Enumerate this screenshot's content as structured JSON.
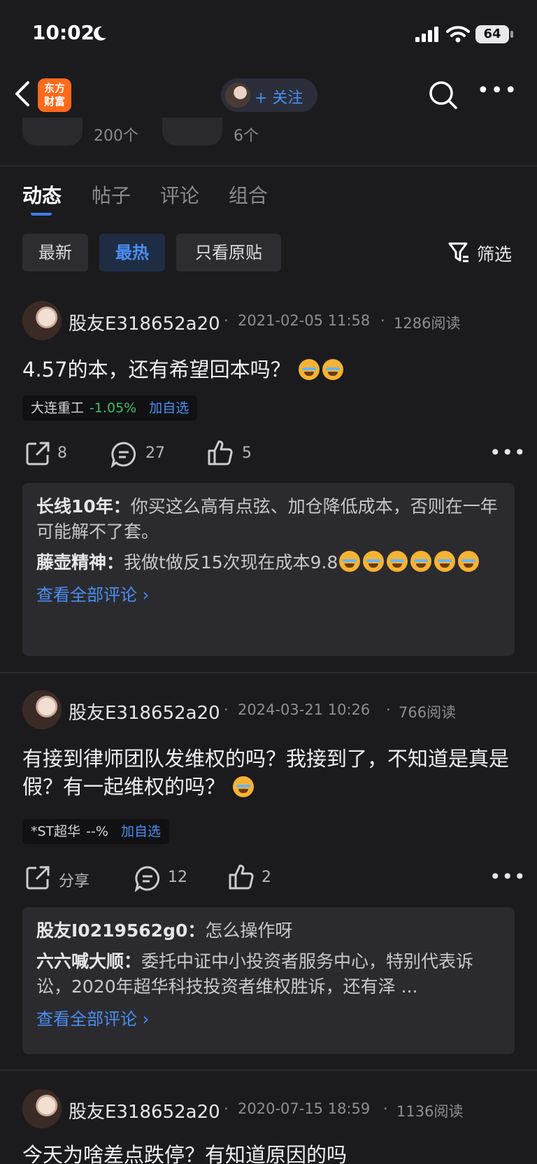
{
  "status_bar": {
    "time": "10:02",
    "battery": "64"
  },
  "nav": {
    "logo_line1": "东方",
    "logo_line2": "财富",
    "follow_label": "+ 关注"
  },
  "stats": [
    {
      "count": "200个"
    },
    {
      "count": "6个"
    }
  ],
  "tabs": [
    {
      "label": "动态"
    },
    {
      "label": "帖子"
    },
    {
      "label": "评论"
    },
    {
      "label": "组合"
    }
  ],
  "filters": {
    "chips": [
      {
        "label": "最新"
      },
      {
        "label": "最热"
      },
      {
        "label": "只看原贴"
      }
    ],
    "filter_label": "筛选"
  },
  "colors": {
    "accent": "#4a8ef2",
    "down": "#3fbf6a",
    "background": "#1b1b1d"
  },
  "posts": [
    {
      "username": "股友E318652a20",
      "date": "2021-02-05 11:58",
      "reads": "1286阅读",
      "text": "4.57的本，还有希望回本吗？",
      "stock": {
        "name": "大连重工",
        "change": "-1.05%",
        "add": "加自选"
      },
      "share": "8",
      "comments": "27",
      "likes": "5",
      "replies": [
        {
          "user": "长线10年：",
          "text": "你买这么高有点弦、加仓降低成本，否则在一年可能解不了套。"
        },
        {
          "user": "藤壶精神：",
          "text": "我做t做反15次现在成本9.8"
        }
      ],
      "view_all": "查看全部评论 ›"
    },
    {
      "username": "股友E318652a20",
      "date": "2024-03-21 10:26",
      "reads": "766阅读",
      "text": "有接到律师团队发维权的吗？我接到了，不知道是真是假？有一起维权的吗？",
      "stock": {
        "name": "*ST超华",
        "change": "--%",
        "add": "加自选"
      },
      "share": "分享",
      "comments": "12",
      "likes": "2",
      "replies": [
        {
          "user": "股友I0219562g0：",
          "text": "怎么操作呀"
        },
        {
          "user": "六六喊大顺：",
          "text": "委托中证中小投资者服务中心，特别代表诉讼，2020年超华科技投资者维权胜诉，还有泽 ..."
        }
      ],
      "view_all": "查看全部评论 ›"
    },
    {
      "username": "股友E318652a20",
      "date": "2020-07-15 18:59",
      "reads": "1136阅读",
      "text": "今天为啥差点跌停？有知道原因的吗"
    }
  ]
}
